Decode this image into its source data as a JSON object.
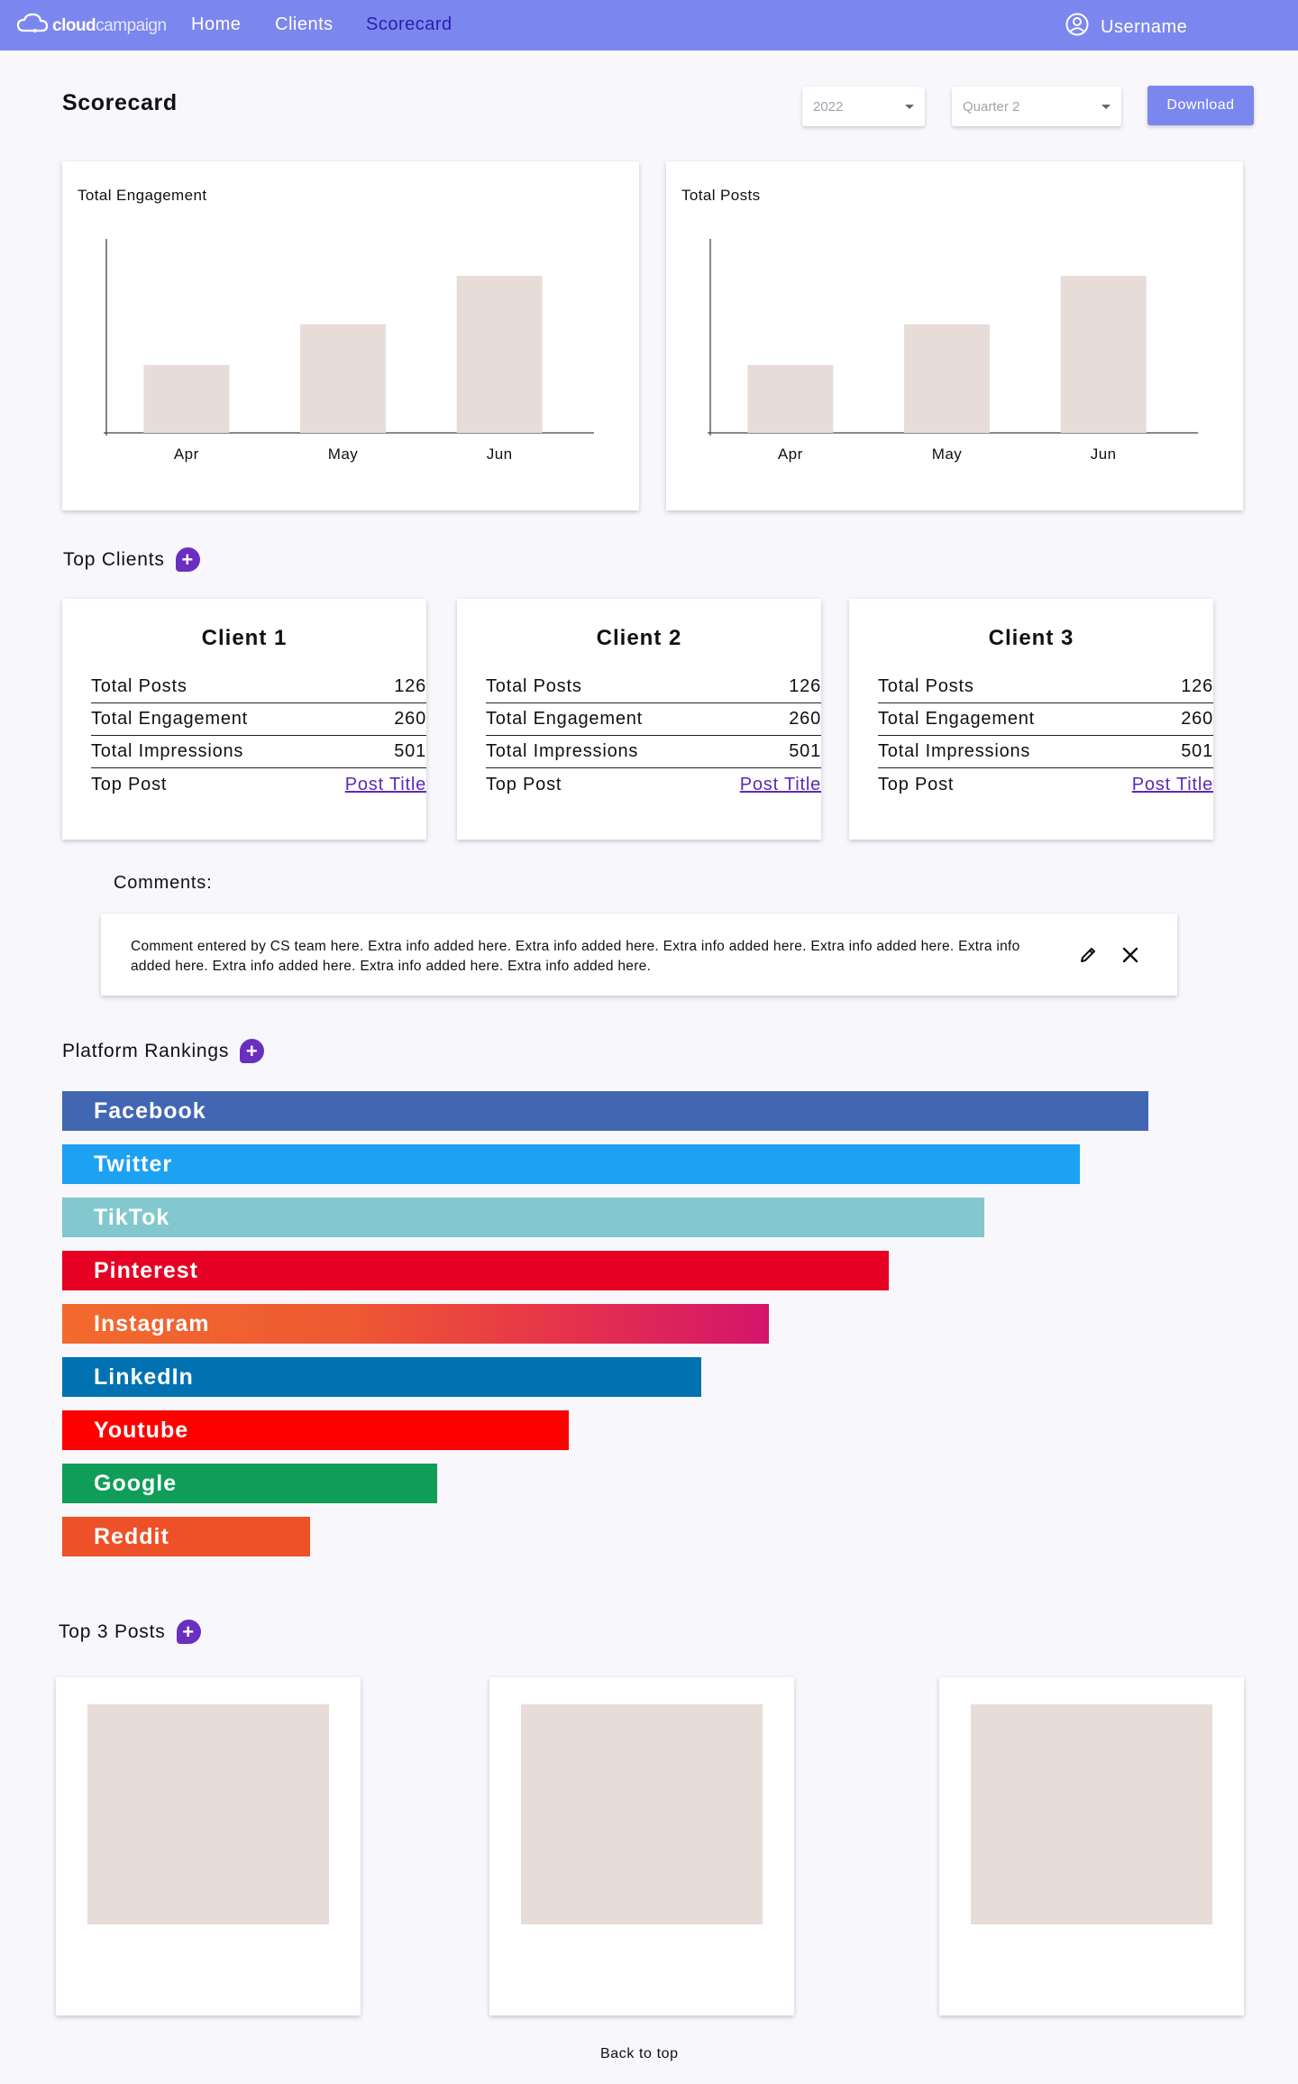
{
  "nav": {
    "logo_bold": "cloud",
    "logo_light": "campaign",
    "links": [
      "Home",
      "Clients",
      "Scorecard"
    ],
    "active": "Scorecard",
    "username": "Username"
  },
  "header": {
    "title": "Scorecard",
    "year": "2022",
    "quarter": "Quarter 2",
    "download_label": "Download"
  },
  "charts": {
    "engagement_title": "Total Engagement",
    "posts_title": "Total Posts"
  },
  "chart_data": [
    {
      "type": "bar",
      "title": "Total Engagement",
      "categories": [
        "Apr",
        "May",
        "Jun"
      ],
      "values": [
        35,
        56,
        81
      ],
      "ylim": [
        0,
        100
      ],
      "color": "#e8dcd9"
    },
    {
      "type": "bar",
      "title": "Total Posts",
      "categories": [
        "Apr",
        "May",
        "Jun"
      ],
      "values": [
        35,
        56,
        81
      ],
      "ylim": [
        0,
        100
      ],
      "color": "#e8dcd9"
    }
  ],
  "top_clients": {
    "title": "Top Clients",
    "clients": [
      {
        "name": "Client 1",
        "rows": [
          [
            "Total Posts",
            "126"
          ],
          [
            "Total Engagement",
            "260"
          ],
          [
            "Total Impressions",
            "501"
          ]
        ],
        "top_post_label": "Top Post",
        "top_post_link": "Post Title"
      },
      {
        "name": "Client 2",
        "rows": [
          [
            "Total Posts",
            "126"
          ],
          [
            "Total Engagement",
            "260"
          ],
          [
            "Total Impressions",
            "501"
          ]
        ],
        "top_post_label": "Top Post",
        "top_post_link": "Post Title"
      },
      {
        "name": "Client 3",
        "rows": [
          [
            "Total Posts",
            "126"
          ],
          [
            "Total Engagement",
            "260"
          ],
          [
            "Total Impressions",
            "501"
          ]
        ],
        "top_post_label": "Top Post",
        "top_post_link": "Post Title"
      }
    ]
  },
  "comments": {
    "label": "Comments:",
    "text": "Comment entered by CS team here. Extra info added here. Extra info added here. Extra info added here. Extra info added here. Extra info added here. Extra info added here. Extra info added here. Extra info added here."
  },
  "platform_rankings": {
    "title": "Platform Rankings",
    "platforms": [
      {
        "name": "Facebook",
        "value": 1.0,
        "color": "#4267b2"
      },
      {
        "name": "Twitter",
        "value": 0.937,
        "color": "#1da1f2"
      },
      {
        "name": "TikTok",
        "value": 0.849,
        "color": "#82c8ce"
      },
      {
        "name": "Pinterest",
        "value": 0.761,
        "color": "#e60023"
      },
      {
        "name": "Instagram",
        "value": 0.651,
        "color": "#e1306c"
      },
      {
        "name": "LinkedIn",
        "value": 0.588,
        "color": "#0072b1"
      },
      {
        "name": "Youtube",
        "value": 0.466,
        "color": "#ff0000"
      },
      {
        "name": "Google",
        "value": 0.345,
        "color": "#0f9d58"
      },
      {
        "name": "Reddit",
        "value": 0.228,
        "color": "#ee5128"
      }
    ]
  },
  "top_posts": {
    "title": "Top 3 Posts",
    "count": 3
  },
  "footer": {
    "back_to_top": "Back to top"
  }
}
